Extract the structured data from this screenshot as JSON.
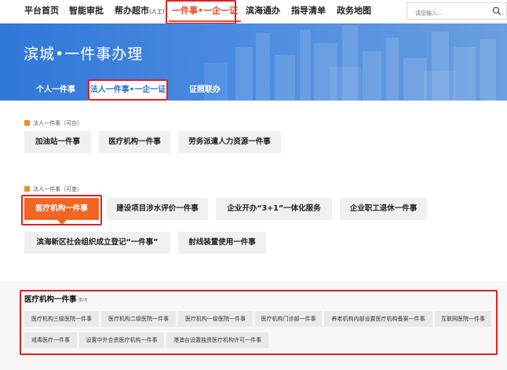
{
  "topnav": {
    "items": [
      {
        "label": "平台首页"
      },
      {
        "label": "智能审批"
      },
      {
        "label": "帮办超市",
        "suffix": "(人工)"
      },
      {
        "label": "一件事•一企一证"
      },
      {
        "label": "滨海通办"
      },
      {
        "label": "指导清单"
      },
      {
        "label": "政务地图"
      }
    ],
    "search_placeholder": "请您输入..."
  },
  "banner": {
    "title": "滨城•一件事办理",
    "tabs": [
      "个人一件事",
      "法人一件事•一企一证",
      "证照联办"
    ]
  },
  "section1": {
    "label": "法人一件事（可办）",
    "items": [
      "加油站一件事",
      "医疗机构一件事",
      "劳务派遣人力资源一件事"
    ]
  },
  "section2": {
    "label": "法人一件事（可查）",
    "items": [
      "医疗机构一件事",
      "建设项目涉水评价一件事",
      "企业开办“3+1”一体化服务",
      "企业职工退休一件事",
      "滨海新区社会组织成立登记“一件事”",
      "射线装置使用一件事"
    ]
  },
  "detail": {
    "title": "医疗机构一件事",
    "note": "事项",
    "items": [
      "医疗机构三级医院一件事",
      "医疗机构二级医院一件事",
      "医疗机构一级医院一件事",
      "医疗机构门诊部一件事",
      "养老机构内部设置医疗机构备案一件事",
      "互联网医院一件事",
      "戒毒医疗一件事",
      "设置中外合资医疗机构一件事",
      "港澳台设置独资医疗机构许可一件事"
    ]
  },
  "colors": {
    "accent_orange": "#f26522",
    "banner_blue": "#2f77d8",
    "highlight_red": "#e02020",
    "active_nav": "#e8492a"
  }
}
